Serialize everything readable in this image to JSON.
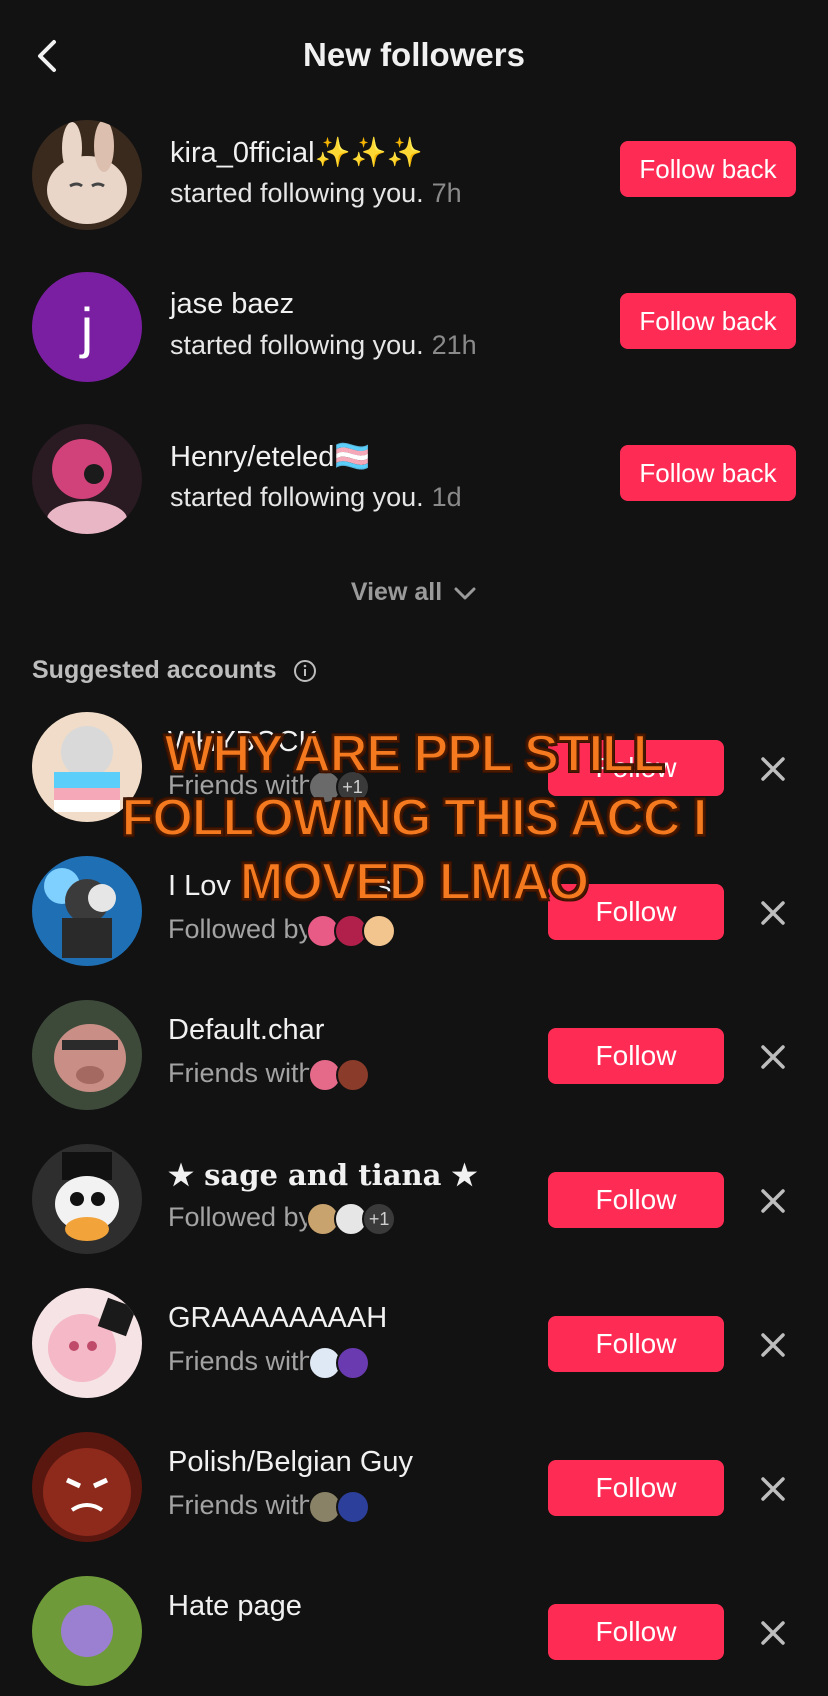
{
  "header": {
    "title": "New followers",
    "back_icon": "chevron-left-icon"
  },
  "followers": [
    {
      "name": "kira_0fficial✨✨✨",
      "action": "started following you.",
      "time": "7h",
      "button": "Follow back",
      "avatar_color": "#c9a98a"
    },
    {
      "name": "jase baez",
      "action": "started following you.",
      "time": "21h",
      "button": "Follow back",
      "avatar_letter": "j",
      "avatar_color": "#7b1fa2"
    },
    {
      "name": "Henry/eteled🏳️‍⚧️",
      "action": "started following you.",
      "time": "1d",
      "button": "Follow back",
      "avatar_color": "#b8345f"
    }
  ],
  "view_all": "View all",
  "suggested_title": "Suggested accounts",
  "suggested": [
    {
      "name": "WHYBOCK",
      "relation": "Friends with",
      "extra": "+1",
      "button": "Follow",
      "avatar_color": "#e8d6c6"
    },
    {
      "name": "I Lov",
      "name_tail": "s",
      "relation": "Followed by",
      "extra": "",
      "button": "Follow",
      "avatar_color": "#2f86c9"
    },
    {
      "name": "Default.char",
      "relation": "Friends with",
      "extra": "",
      "button": "Follow",
      "avatar_color": "#4d5a4a"
    },
    {
      "name": "★ sage and tiana ★",
      "relation": "Followed by",
      "extra": "+1",
      "button": "Follow",
      "avatar_color": "#ececec"
    },
    {
      "name": "GRAAAAAAAAH",
      "relation": "Friends with",
      "extra": "",
      "button": "Follow",
      "avatar_color": "#f4c4cc"
    },
    {
      "name": "Polish/Belgian Guy",
      "relation": "Friends with",
      "extra": "",
      "button": "Follow",
      "avatar_color": "#8e2a1c"
    },
    {
      "name": "Hate page",
      "relation": "",
      "extra": "",
      "button": "Follow",
      "avatar_color": "#6f9a3a"
    }
  ],
  "overlay_text": "WHY ARE PPL STILL FOLLOWING THIS ACC I MOVED LMAO",
  "colors": {
    "accent": "#fe2c55",
    "background": "#121212",
    "overlay": "#f57a1f"
  }
}
